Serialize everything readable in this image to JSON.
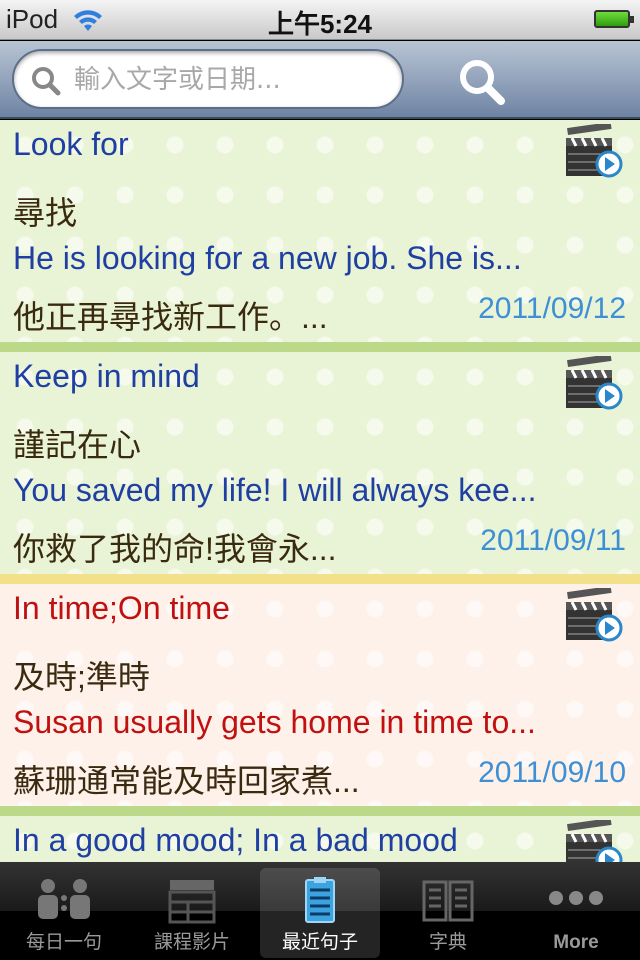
{
  "status": {
    "carrier": "iPod",
    "time": "上午5:24"
  },
  "search": {
    "placeholder": "輸入文字或日期..."
  },
  "items": [
    {
      "title": "Look for",
      "chinese": "尋找",
      "sentence": "He is looking for a new job.  She is...",
      "translation": "他正再尋找新工作。...",
      "date": "2011/09/12",
      "theme": "green"
    },
    {
      "title": "Keep in mind",
      "chinese": "謹記在心",
      "sentence": "You saved my life! I will always kee...",
      "translation": "你救了我的命!我會永...",
      "date": "2011/09/11",
      "theme": "green"
    },
    {
      "title": "In time;On time",
      "chinese": "及時;準時",
      "sentence": "Susan usually gets home in time to...",
      "translation": "蘇珊通常能及時回家煮...",
      "date": "2011/09/10",
      "theme": "pink"
    },
    {
      "title": "In a good mood; In a bad  mood",
      "theme": "green"
    }
  ],
  "tabs": [
    {
      "label": "每日一句",
      "icon": "people-icon"
    },
    {
      "label": "課程影片",
      "icon": "clapperboard-icon"
    },
    {
      "label": "最近句子",
      "icon": "clipboard-list-icon",
      "selected": true
    },
    {
      "label": "字典",
      "icon": "book-icon"
    },
    {
      "label": "More",
      "icon": "more-dots-icon"
    }
  ],
  "colors": {
    "accent": "#3d8fd6",
    "title_blue": "#1f3fa3",
    "title_red": "#c01010"
  }
}
